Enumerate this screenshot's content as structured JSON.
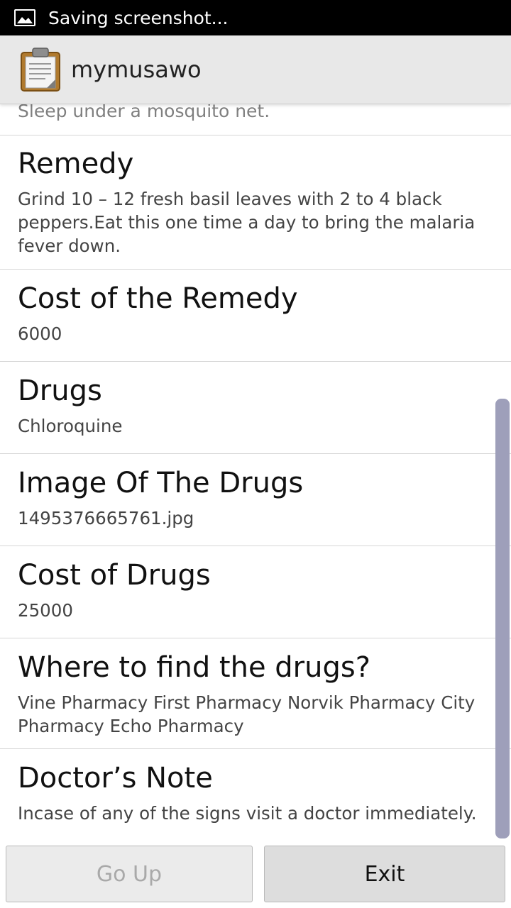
{
  "status_bar": {
    "icon": "image-icon",
    "text": "Saving screenshot..."
  },
  "action_bar": {
    "icon": "clipboard-icon",
    "title": "mymusawo"
  },
  "partial_item": {
    "value": "Sleep under a mosquito net."
  },
  "items": [
    {
      "label": "Remedy",
      "value": "Grind 10 – 12 fresh basil leaves with 2 to 4 black peppers.Eat this one time a day to bring the malaria fever down."
    },
    {
      "label": "Cost of the Remedy",
      "value": "6000"
    },
    {
      "label": "Drugs",
      "value": "Chloroquine"
    },
    {
      "label": "Image Of The Drugs",
      "value": "1495376665761.jpg"
    },
    {
      "label": "Cost of Drugs",
      "value": "25000"
    },
    {
      "label": "Where to find the drugs?",
      "value": "Vine Pharmacy First Pharmacy Norvik Pharmacy City Pharmacy Echo Pharmacy"
    },
    {
      "label": "Doctor’s Note",
      "value": "Incase of any of the signs visit a doctor immediately."
    }
  ],
  "buttons": {
    "go_up": "Go Up",
    "exit": "Exit"
  },
  "colors": {
    "status_bar": "#000000",
    "action_bar": "#e8e8e8",
    "scrollbar": "#9e9fba",
    "divider": "#d6d6d6"
  }
}
